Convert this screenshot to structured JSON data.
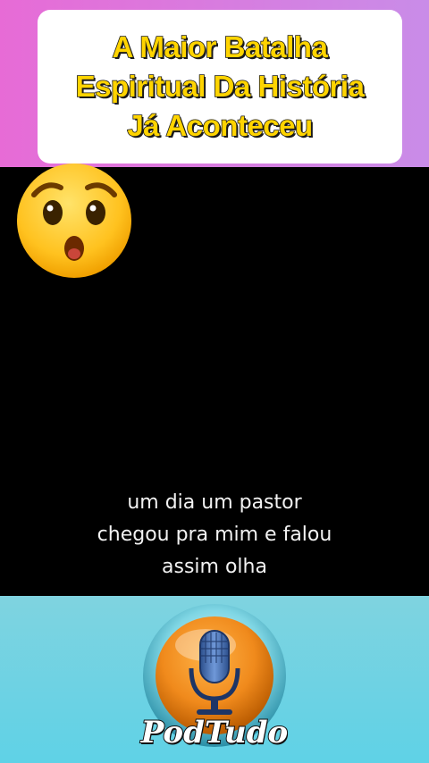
{
  "header": {
    "title_lines": [
      "A Maior Batalha",
      "Espiritual Da História",
      "Já Aconteceu"
    ]
  },
  "video": {
    "reaction_emoji": "hushed-face-icon",
    "subtitle_lines": [
      "um dia um pastor",
      "chegou pra mim e falou",
      "assim olha"
    ]
  },
  "footer": {
    "logo_text": "PodTudo",
    "logo_icon": "microphone-icon"
  },
  "colors": {
    "title_fill": "#ffd400",
    "top_background": "#e76bd6",
    "bottom_background": "#7fd3e0",
    "logo_orange": "#f08a1c"
  }
}
